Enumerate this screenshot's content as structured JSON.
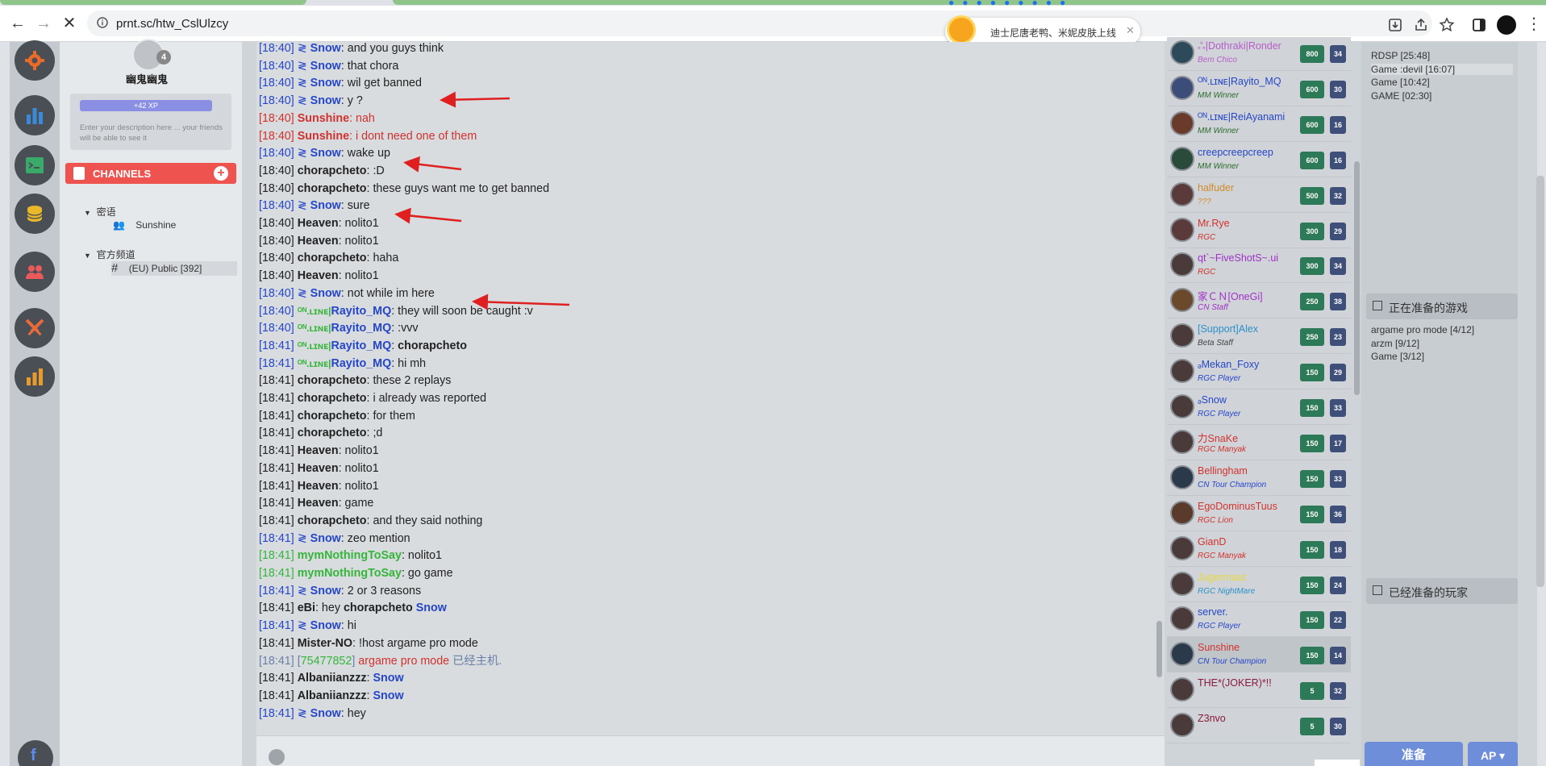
{
  "browser": {
    "url": "prnt.sc/htw_CslUlzcy",
    "notification": "迪士尼唐老鸭、米妮皮肤上线"
  },
  "profile": {
    "username": "幽鬼幽鬼",
    "badge_count": "4",
    "xp_label": "+42 XP",
    "description_placeholder": "Enter your description here ... your friends will be able to see it"
  },
  "channels": {
    "header": "CHANNELS",
    "groups": [
      {
        "name": "密语",
        "items": [
          {
            "label": "Sunshine"
          }
        ]
      },
      {
        "name": "官方频道",
        "items": [
          {
            "label": "(EU) Public [392]"
          }
        ]
      }
    ]
  },
  "chat": {
    "messages": [
      {
        "time": "[18:40]",
        "prefix": "≷ ",
        "user": "Snow",
        "text": ": and you guys think",
        "color": "blue"
      },
      {
        "time": "[18:40]",
        "prefix": "≷ ",
        "user": "Snow",
        "text": ": that chora",
        "color": "blue"
      },
      {
        "time": "[18:40]",
        "prefix": "≷ ",
        "user": "Snow",
        "text": ": wil get banned",
        "color": "blue"
      },
      {
        "time": "[18:40]",
        "prefix": "≷ ",
        "user": "Snow",
        "text": ": y ?",
        "color": "blue"
      },
      {
        "time": "[18:40]",
        "prefix": "",
        "user": "Sunshine",
        "text": ": nah",
        "color": "red"
      },
      {
        "time": "[18:40]",
        "prefix": "",
        "user": "Sunshine",
        "text": ": i dont need one of them",
        "color": "red"
      },
      {
        "time": "[18:40]",
        "prefix": "≷ ",
        "user": "Snow",
        "text": ": wake up",
        "color": "blue"
      },
      {
        "time": "[18:40]",
        "prefix": "",
        "user": "chorapcheto",
        "text": ": :D",
        "color": "black"
      },
      {
        "time": "[18:40]",
        "prefix": "",
        "user": "chorapcheto",
        "text": ": these guys want me to get banned",
        "color": "black"
      },
      {
        "time": "[18:40]",
        "prefix": "≷ ",
        "user": "Snow",
        "text": ": sure",
        "color": "blue"
      },
      {
        "time": "[18:40]",
        "prefix": "",
        "user": "Heaven",
        "text": ": nolito1",
        "color": "black"
      },
      {
        "time": "[18:40]",
        "prefix": "",
        "user": "Heaven",
        "text": ": nolito1",
        "color": "black"
      },
      {
        "time": "[18:40]",
        "prefix": "",
        "user": "chorapcheto",
        "text": ": haha",
        "color": "black"
      },
      {
        "time": "[18:40]",
        "prefix": "",
        "user": "Heaven",
        "text": ": nolito1",
        "color": "black"
      },
      {
        "time": "[18:40]",
        "prefix": "≷ ",
        "user": "Snow",
        "text": ": not while im here",
        "color": "blue"
      },
      {
        "time": "[18:40]",
        "prefix": "ᴼᴺ.ʟɪɴᴇ|",
        "user": "Rayito_MQ",
        "text": ": they will soon be caught :v",
        "color": "online"
      },
      {
        "time": "[18:40]",
        "prefix": "ᴼᴺ.ʟɪɴᴇ|",
        "user": "Rayito_MQ",
        "text": ": :vvv",
        "color": "online"
      },
      {
        "time": "[18:41]",
        "prefix": "ᴼᴺ.ʟɪɴᴇ|",
        "user": "Rayito_MQ",
        "text": ": ",
        "bold_text": "chorapcheto",
        "color": "online"
      },
      {
        "time": "[18:41]",
        "prefix": "ᴼᴺ.ʟɪɴᴇ|",
        "user": "Rayito_MQ",
        "text": ": hi mh",
        "color": "online"
      },
      {
        "time": "[18:41]",
        "prefix": "",
        "user": "chorapcheto",
        "text": ": these 2 replays",
        "color": "black"
      },
      {
        "time": "[18:41]",
        "prefix": "",
        "user": "chorapcheto",
        "text": ": i already was reported",
        "color": "black"
      },
      {
        "time": "[18:41]",
        "prefix": "",
        "user": "chorapcheto",
        "text": ": for them",
        "color": "black"
      },
      {
        "time": "[18:41]",
        "prefix": "",
        "user": "chorapcheto",
        "text": ": ;d",
        "color": "black"
      },
      {
        "time": "[18:41]",
        "prefix": "",
        "user": "Heaven",
        "text": ": nolito1",
        "color": "black"
      },
      {
        "time": "[18:41]",
        "prefix": "",
        "user": "Heaven",
        "text": ": nolito1",
        "color": "black"
      },
      {
        "time": "[18:41]",
        "prefix": "",
        "user": "Heaven",
        "text": ": nolito1",
        "color": "black"
      },
      {
        "time": "[18:41]",
        "prefix": "",
        "user": "Heaven",
        "text": ": game",
        "color": "black"
      },
      {
        "time": "[18:41]",
        "prefix": "",
        "user": "chorapcheto",
        "text": ": and they said nothing",
        "color": "black"
      },
      {
        "time": "[18:41]",
        "prefix": "≷ ",
        "user": "Snow",
        "text": ": zeo mention",
        "color": "blue"
      },
      {
        "time": "[18:41]",
        "prefix": "",
        "user": "mymNothingToSay",
        "text": ": nolito1",
        "color": "green"
      },
      {
        "time": "[18:41]",
        "prefix": "",
        "user": "mymNothingToSay",
        "text": ": go game",
        "color": "green"
      },
      {
        "time": "[18:41]",
        "prefix": "≷ ",
        "user": "Snow",
        "text": ": 2 or 3 reasons",
        "color": "blue"
      },
      {
        "time": "[18:41]",
        "prefix": "",
        "user": "eBi",
        "text": ": hey ",
        "bold_text": "chorapcheto",
        "tail_user": " Snow",
        "color": "black"
      },
      {
        "time": "[18:41]",
        "prefix": "≷ ",
        "user": "Snow",
        "text": ": hi",
        "color": "blue"
      },
      {
        "time": "[18:41]",
        "prefix": "",
        "user": "Mister-NO",
        "text": ": !host argame pro mode",
        "color": "black"
      },
      {
        "time": "[18:41]",
        "prefix": "[",
        "user": "75477852",
        "text": "] ",
        "game": "argame pro mode",
        "after": " 已经主机.",
        "color": "system"
      },
      {
        "time": "[18:41]",
        "prefix": "",
        "user": "Albaniianzzz",
        "text": ": ",
        "tail_user": "Snow",
        "color": "black"
      },
      {
        "time": "[18:41]",
        "prefix": "",
        "user": "Albaniianzzz",
        "text": ": ",
        "tail_user": "Snow",
        "color": "black"
      },
      {
        "time": "[18:41]",
        "prefix": "≷ ",
        "user": "Snow",
        "text": ": hey",
        "color": "blue"
      }
    ]
  },
  "players": [
    {
      "name": "ஃ|Dothraki|Ronder",
      "role": "Bem Chico",
      "lvl": "800",
      "num": "34",
      "name_color": "#b85cc8",
      "role_color": "#b85cc8",
      "avatar": "#2c4a5a"
    },
    {
      "name": "ᴼᴺ.ʟɪɴᴇ|Rayito_MQ",
      "role": "MM Winner",
      "lvl": "600",
      "num": "30",
      "name_color": "#2546c9",
      "role_color": "#2b6a2b",
      "avatar": "#3d4d7a"
    },
    {
      "name": "ᴼᴺ.ʟɪɴᴇ|ReiAyanami",
      "role": "MM Winner",
      "lvl": "600",
      "num": "16",
      "name_color": "#2546c9",
      "role_color": "#2b6a2b",
      "avatar": "#6a3a2a"
    },
    {
      "name": "creepcreepcreep",
      "role": "MM Winner",
      "lvl": "600",
      "num": "16",
      "name_color": "#2546c9",
      "role_color": "#2b6a2b",
      "avatar": "#2a4a3a"
    },
    {
      "name": "halfuder",
      "role": "???",
      "lvl": "500",
      "num": "32",
      "name_color": "#d08a2a",
      "role_color": "#d08a2a",
      "avatar": "#5a3a3a"
    },
    {
      "name": "Mr.Rye",
      "role": "RGC",
      "lvl": "300",
      "num": "29",
      "name_color": "#d2322e",
      "role_color": "#d2322e",
      "avatar": "#5a3a3a"
    },
    {
      "name": "qt`~FiveShotS~.ui",
      "role": "RGC",
      "lvl": "300",
      "num": "34",
      "name_color": "#a030c8",
      "role_color": "#d2322e",
      "avatar": "#4a3a3a"
    },
    {
      "name": "家ＣＮ[OneGi]",
      "role": "CN Staff",
      "lvl": "250",
      "num": "38",
      "name_color": "#a030c8",
      "role_color": "#a030c8",
      "avatar": "#6a4a2a"
    },
    {
      "name": "[Support]Alex",
      "role": "Beta Staff",
      "lvl": "250",
      "num": "23",
      "name_color": "#2a90c8",
      "role_color": "#444",
      "avatar": "#4a3a3a"
    },
    {
      "name": "ₔMekan_Foxy",
      "role": "RGC Player",
      "lvl": "150",
      "num": "29",
      "name_color": "#2546c9",
      "role_color": "#2546c9",
      "avatar": "#4a3a3a"
    },
    {
      "name": "ₔSnow",
      "role": "RGC Player",
      "lvl": "150",
      "num": "33",
      "name_color": "#2546c9",
      "role_color": "#2546c9",
      "avatar": "#4a3a3a"
    },
    {
      "name": "力SnaKe",
      "role": "RGC Manyak",
      "lvl": "150",
      "num": "17",
      "name_color": "#d2322e",
      "role_color": "#d2322e",
      "avatar": "#4a3a3a"
    },
    {
      "name": "Bellingham",
      "role": "CN Tour Champion",
      "lvl": "150",
      "num": "33",
      "name_color": "#d2322e",
      "role_color": "#2546c9",
      "avatar": "#2a3a4a"
    },
    {
      "name": "EgoDominusTuus",
      "role": "RGC Lion",
      "lvl": "150",
      "num": "36",
      "name_color": "#d2322e",
      "role_color": "#d2322e",
      "avatar": "#5a3a2a"
    },
    {
      "name": "GianD",
      "role": "RGC Manyak",
      "lvl": "150",
      "num": "18",
      "name_color": "#d2322e",
      "role_color": "#d2322e",
      "avatar": "#4a3a3a"
    },
    {
      "name": "Jugerrnaut",
      "role": "RGC NightMare",
      "lvl": "150",
      "num": "24",
      "name_color": "#e8d83a",
      "role_color": "#2a90c8",
      "avatar": "#4a3a3a"
    },
    {
      "name": "server.",
      "role": "RGC Player",
      "lvl": "150",
      "num": "22",
      "name_color": "#2546c9",
      "role_color": "#2546c9",
      "avatar": "#4a3a3a"
    },
    {
      "name": "Sunshine",
      "role": "CN Tour Champion",
      "lvl": "150",
      "num": "14",
      "name_color": "#d2322e",
      "role_color": "#2546c9",
      "avatar": "#2a3a4a"
    },
    {
      "name": "THE*(JOKER)*!!",
      "role": "",
      "lvl": "5",
      "num": "32",
      "name_color": "#8a1a3a",
      "role_color": "#444",
      "avatar": "#4a3a3a"
    },
    {
      "name": "Z3nvo",
      "role": "",
      "lvl": "5",
      "num": "30",
      "name_color": "#8a1a3a",
      "role_color": "#444",
      "avatar": "#4a3a3a"
    }
  ],
  "games": {
    "hosting_list": [
      "RDSP [25:48]",
      "Game :devil [16:07]",
      "Game [10:42]",
      "GAME [02:30]"
    ],
    "preparing_header": "正在准备的游戏",
    "preparing_list": [
      "argame pro mode [4/12]",
      "arzm [9/12]",
      "Game [3/12]"
    ],
    "ready_players_header": "已经准备的玩家",
    "ready_button": "准备",
    "ap_button": "AP"
  }
}
